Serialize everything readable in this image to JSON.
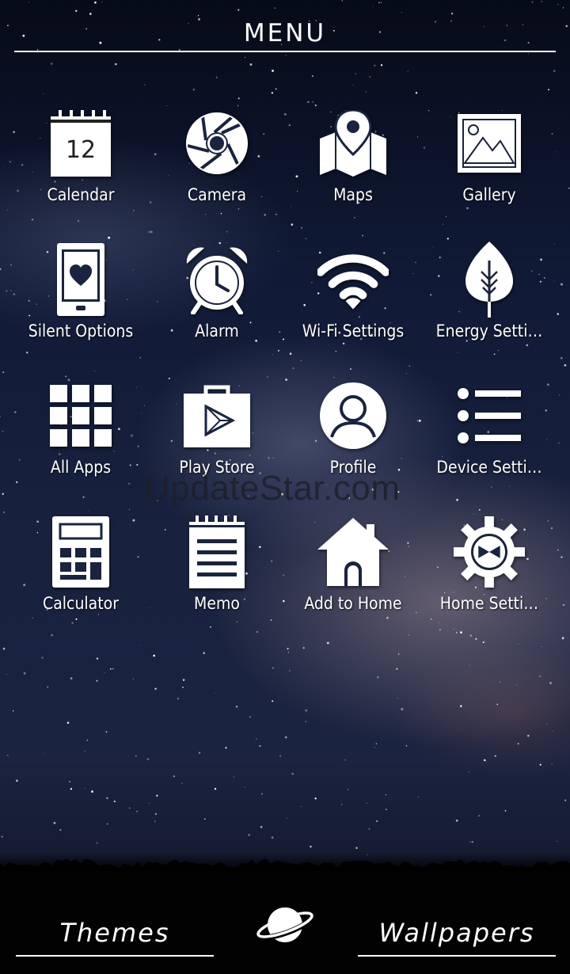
{
  "header": {
    "title": "MENU"
  },
  "apps": [
    {
      "label": "Calendar",
      "icon": "calendar-icon",
      "calendar_day": "12"
    },
    {
      "label": "Camera",
      "icon": "camera-shutter-icon"
    },
    {
      "label": "Maps",
      "icon": "map-pin-icon"
    },
    {
      "label": "Gallery",
      "icon": "image-icon"
    },
    {
      "label": "Silent Options",
      "icon": "phone-heart-icon"
    },
    {
      "label": "Alarm",
      "icon": "alarm-clock-icon"
    },
    {
      "label": "Wi-Fi Settings",
      "icon": "wifi-icon"
    },
    {
      "label": "Energy Setti…",
      "icon": "leaf-icon"
    },
    {
      "label": "All Apps",
      "icon": "grid-icon"
    },
    {
      "label": "Play Store",
      "icon": "shopping-bag-play-icon"
    },
    {
      "label": "Profile",
      "icon": "user-icon"
    },
    {
      "label": "Device Setti…",
      "icon": "list-icon"
    },
    {
      "label": "Calculator",
      "icon": "calculator-icon"
    },
    {
      "label": "Memo",
      "icon": "notepad-icon"
    },
    {
      "label": "Add to Home",
      "icon": "house-icon"
    },
    {
      "label": "Home Setti…",
      "icon": "gear-icon"
    }
  ],
  "watermark": "UpdateStar.com",
  "footer": {
    "themes_label": "Themes",
    "wallpapers_label": "Wallpapers"
  },
  "colors": {
    "icon": "#ffffff",
    "background": "#101a36"
  }
}
